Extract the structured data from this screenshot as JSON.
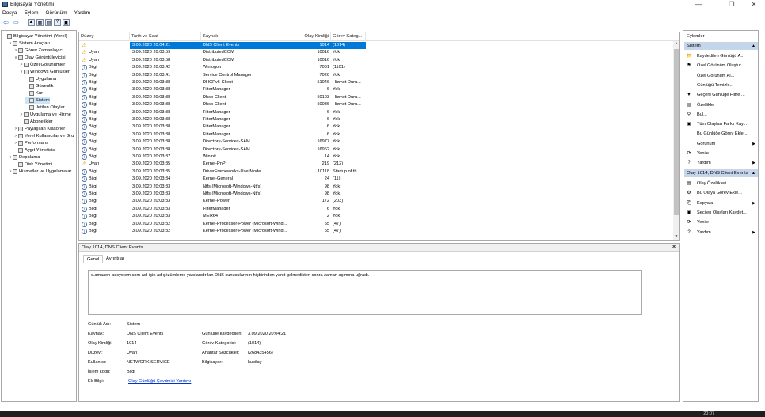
{
  "window": {
    "title": "Bilgisayar Yönetimi",
    "min": "—",
    "max": "❐",
    "close": "✕"
  },
  "menu": [
    "Dosya",
    "Eylem",
    "Görünüm",
    "Yardım"
  ],
  "tree": [
    {
      "label": "Bilgisayar Yönetimi (Yerel)",
      "indent": 0,
      "exp": ""
    },
    {
      "label": "Sistem Araçları",
      "indent": 1,
      "exp": "∨"
    },
    {
      "label": "Görev Zamanlayıcı",
      "indent": 2,
      "exp": ">"
    },
    {
      "label": "Olay Görüntüleyicisi",
      "indent": 2,
      "exp": "∨"
    },
    {
      "label": "Özel Görünümler",
      "indent": 3,
      "exp": ">"
    },
    {
      "label": "Windows Günlükleri",
      "indent": 3,
      "exp": "∨"
    },
    {
      "label": "Uygulama",
      "indent": 4,
      "exp": ""
    },
    {
      "label": "Güvenlik",
      "indent": 4,
      "exp": ""
    },
    {
      "label": "Kur",
      "indent": 4,
      "exp": ""
    },
    {
      "label": "Sistem",
      "indent": 4,
      "exp": "",
      "selected": true
    },
    {
      "label": "İletilen Olaylar",
      "indent": 4,
      "exp": ""
    },
    {
      "label": "Uygulama ve Hizme",
      "indent": 3,
      "exp": ">"
    },
    {
      "label": "Abonelikler",
      "indent": 3,
      "exp": ""
    },
    {
      "label": "Paylaşılan Klasörler",
      "indent": 2,
      "exp": ">"
    },
    {
      "label": "Yerel Kullanıcılar ve Gru",
      "indent": 2,
      "exp": ">"
    },
    {
      "label": "Performans",
      "indent": 2,
      "exp": ">"
    },
    {
      "label": "Aygıt Yöneticisi",
      "indent": 2,
      "exp": ""
    },
    {
      "label": "Depolama",
      "indent": 1,
      "exp": "∨"
    },
    {
      "label": "Disk Yönetimi",
      "indent": 2,
      "exp": ""
    },
    {
      "label": "Hizmetler ve Uygulamalar",
      "indent": 1,
      "exp": ">"
    }
  ],
  "columns": [
    "Düzey",
    "Tarih ve Saat",
    "Kaynak",
    "Olay Kimliği",
    "Görev Kateg..."
  ],
  "events": [
    {
      "level": "Uyarı",
      "type": "warn",
      "date": "3.09.2020 20:04:21",
      "source": "DNS Client Events",
      "id": "1014",
      "cat": "(1014)",
      "selected": true
    },
    {
      "level": "Uyarı",
      "type": "warn",
      "date": "3.09.2020 20:03:59",
      "source": "DistributedCOM",
      "id": "10016",
      "cat": "Yok"
    },
    {
      "level": "Uyarı",
      "type": "warn",
      "date": "3.09.2020 20:03:58",
      "source": "DistributedCOM",
      "id": "10016",
      "cat": "Yok"
    },
    {
      "level": "Bilgi",
      "type": "info",
      "date": "3.09.2020 20:03:42",
      "source": "Winlogon",
      "id": "7001",
      "cat": "(1101)"
    },
    {
      "level": "Bilgi",
      "type": "info",
      "date": "3.09.2020 20:03:41",
      "source": "Service Control Manager",
      "id": "7026",
      "cat": "Yok"
    },
    {
      "level": "Bilgi",
      "type": "info",
      "date": "3.09.2020 20:03:38",
      "source": "DHCPv6-Client",
      "id": "51046",
      "cat": "Hizmet Duru..."
    },
    {
      "level": "Bilgi",
      "type": "info",
      "date": "3.09.2020 20:03:38",
      "source": "FilterManager",
      "id": "6",
      "cat": "Yok"
    },
    {
      "level": "Bilgi",
      "type": "info",
      "date": "3.09.2020 20:03:38",
      "source": "Dhcp-Client",
      "id": "50103",
      "cat": "Hizmet Duru..."
    },
    {
      "level": "Bilgi",
      "type": "info",
      "date": "3.09.2020 20:03:38",
      "source": "Dhcp-Client",
      "id": "50036",
      "cat": "Hizmet Duru..."
    },
    {
      "level": "Bilgi",
      "type": "info",
      "date": "3.09.2020 20:03:38",
      "source": "FilterManager",
      "id": "6",
      "cat": "Yok"
    },
    {
      "level": "Bilgi",
      "type": "info",
      "date": "3.09.2020 20:03:38",
      "source": "FilterManager",
      "id": "6",
      "cat": "Yok"
    },
    {
      "level": "Bilgi",
      "type": "info",
      "date": "3.09.2020 20:03:38",
      "source": "FilterManager",
      "id": "6",
      "cat": "Yok"
    },
    {
      "level": "Bilgi",
      "type": "info",
      "date": "3.09.2020 20:03:38",
      "source": "FilterManager",
      "id": "6",
      "cat": "Yok"
    },
    {
      "level": "Bilgi",
      "type": "info",
      "date": "3.09.2020 20:03:38",
      "source": "Directory-Services-SAM",
      "id": "16977",
      "cat": "Yok"
    },
    {
      "level": "Bilgi",
      "type": "info",
      "date": "3.09.2020 20:03:38",
      "source": "Directory-Services-SAM",
      "id": "16962",
      "cat": "Yok"
    },
    {
      "level": "Bilgi",
      "type": "info",
      "date": "3.09.2020 20:03:37",
      "source": "Wininit",
      "id": "14",
      "cat": "Yok"
    },
    {
      "level": "Uyarı",
      "type": "warn",
      "date": "3.09.2020 20:03:35",
      "source": "Kernel-PnP",
      "id": "219",
      "cat": "(212)"
    },
    {
      "level": "Bilgi",
      "type": "info",
      "date": "3.09.2020 20:03:35",
      "source": "DriverFrameworks-UserMode",
      "id": "10118",
      "cat": "Startup of th..."
    },
    {
      "level": "Bilgi",
      "type": "info",
      "date": "3.09.2020 20:03:34",
      "source": "Kernel-General",
      "id": "24",
      "cat": "(11)"
    },
    {
      "level": "Bilgi",
      "type": "info",
      "date": "3.09.2020 20:03:33",
      "source": "Ntfs (Microsoft-Windows-Ntfs)",
      "id": "98",
      "cat": "Yok"
    },
    {
      "level": "Bilgi",
      "type": "info",
      "date": "3.09.2020 20:03:33",
      "source": "Ntfs (Microsoft-Windows-Ntfs)",
      "id": "98",
      "cat": "Yok"
    },
    {
      "level": "Bilgi",
      "type": "info",
      "date": "3.09.2020 20:03:33",
      "source": "Kernel-Power",
      "id": "172",
      "cat": "(203)"
    },
    {
      "level": "Bilgi",
      "type": "info",
      "date": "3.09.2020 20:03:33",
      "source": "FilterManager",
      "id": "6",
      "cat": "Yok"
    },
    {
      "level": "Bilgi",
      "type": "info",
      "date": "3.09.2020 20:03:33",
      "source": "MEIx64",
      "id": "2",
      "cat": "Yok"
    },
    {
      "level": "Bilgi",
      "type": "info",
      "date": "3.09.2020 20:03:32",
      "source": "Kernel-Processor-Power (Microsoft-Wind...",
      "id": "55",
      "cat": "(47)"
    },
    {
      "level": "Bilgi",
      "type": "info",
      "date": "3.09.2020 20:03:32",
      "source": "Kernel-Processor-Power (Microsoft-Wind...",
      "id": "55",
      "cat": "(47)"
    }
  ],
  "details": {
    "title": "Olay 1014, DNS Client Events",
    "tabs": [
      "Genel",
      "Ayrıntılar"
    ],
    "message": "c.amazon-adsystem.com adı için ad çözümleme yapılandırılan DNS sunucularının hiçbirinden yanıt gelmedikten sonra zaman aşımına uğradı.",
    "log_name_label": "Günlük Adı:",
    "log_name": "Sistem",
    "source_label": "Kaynak:",
    "source": "DNS Client Events",
    "logged_label": "Günlüğe kaydedilen:",
    "logged": "3.09.2020 20:04:21",
    "event_id_label": "Olay Kimliği:",
    "event_id": "1014",
    "task_label": "Görev Kategorisi:",
    "task": "(1014)",
    "level_label": "Düzeyi:",
    "level": "Uyarı",
    "keywords_label": "Anahtar Sözcükler:",
    "keywords": "(268435456)",
    "user_label": "Kullanıcı:",
    "user": "NETWORK SERVICE",
    "computer_label": "Bilgisayar:",
    "computer": "kubilay",
    "opcode_label": "İşlem kodu:",
    "opcode": "Bilgi",
    "more_label": "Ek Bilgi:",
    "more_link": "Olay Günlüğü Çevrimiçi Yardımı"
  },
  "actions": {
    "header": "Eylemler",
    "section1": "Sistem",
    "items1": [
      {
        "label": "Kaydedilen Günlüğü A...",
        "icon": "📂",
        "arrow": ""
      },
      {
        "label": "Özel Görünüm Oluştur...",
        "icon": "⚑",
        "arrow": ""
      },
      {
        "label": "Özel Görünüm Al...",
        "icon": "",
        "arrow": ""
      },
      {
        "label": "Günlüğü Temizle...",
        "icon": "",
        "arrow": ""
      },
      {
        "label": "Geçerli Günlüğe Filtre ...",
        "icon": "▼",
        "arrow": ""
      },
      {
        "label": "Özellikler",
        "icon": "▤",
        "arrow": ""
      },
      {
        "label": "Bul...",
        "icon": "⚲",
        "arrow": ""
      },
      {
        "label": "Tüm Olayları Farklı Kay...",
        "icon": "▣",
        "arrow": ""
      },
      {
        "label": "Bu Günlüğe Görev Ekle...",
        "icon": "",
        "arrow": ""
      },
      {
        "label": "Görünüm",
        "icon": "",
        "arrow": "▶"
      },
      {
        "label": "Yenile",
        "icon": "⟳",
        "arrow": ""
      },
      {
        "label": "Yardım",
        "icon": "?",
        "arrow": "▶"
      }
    ],
    "section2": "Olay 1014, DNS Client Events",
    "items2": [
      {
        "label": "Olay Özellikleri",
        "icon": "▤",
        "arrow": ""
      },
      {
        "label": "Bu Olaya Görev Ekle...",
        "icon": "⚙",
        "arrow": ""
      },
      {
        "label": "Kopyala",
        "icon": "⎘",
        "arrow": "▶"
      },
      {
        "label": "Seçilen Olayları Kaydet...",
        "icon": "▣",
        "arrow": ""
      },
      {
        "label": "Yenile",
        "icon": "⟳",
        "arrow": ""
      },
      {
        "label": "Yardım",
        "icon": "?",
        "arrow": "▶"
      }
    ]
  },
  "taskbar": {
    "clock": "20:07"
  }
}
